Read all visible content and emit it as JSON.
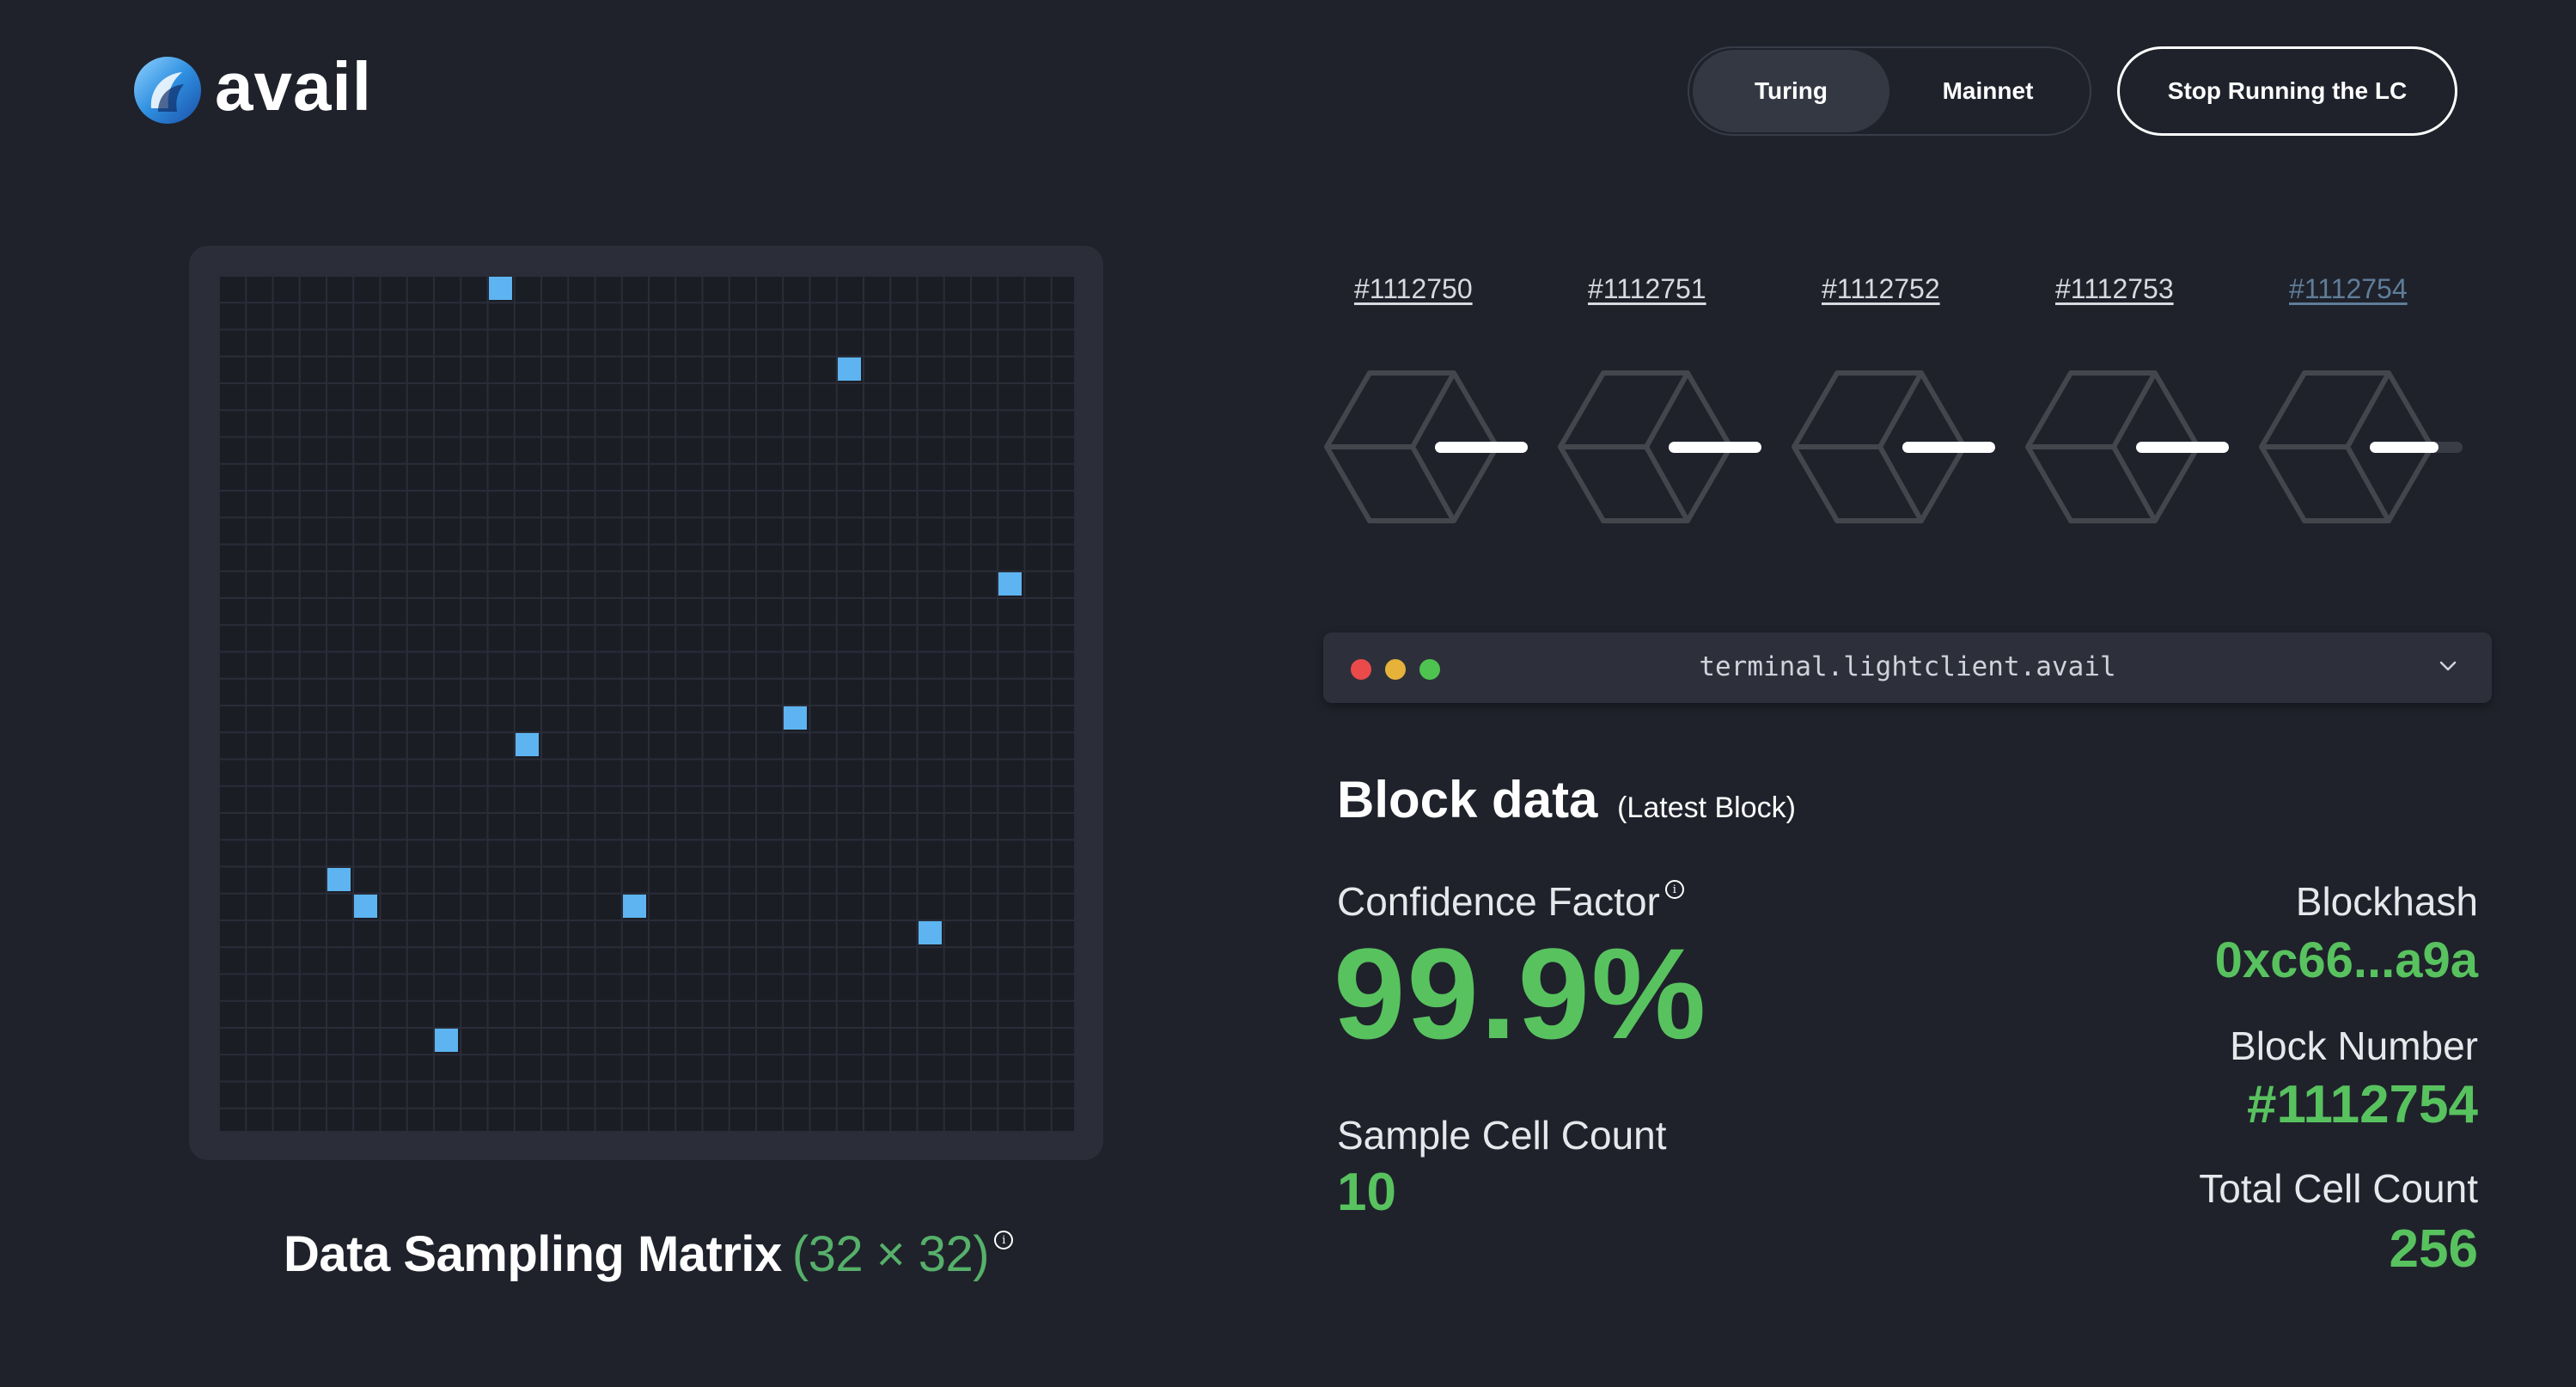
{
  "header": {
    "logo_text": "avail",
    "networks": [
      "Turing",
      "Mainnet"
    ],
    "active_network": "Turing",
    "stop_button_label": "Stop Running the LC"
  },
  "matrix": {
    "caption": "Data Sampling Matrix",
    "dimensions": "(32 × 32)",
    "rows": 32,
    "cols": 32,
    "sampled_cells": [
      {
        "row": 0,
        "col": 10
      },
      {
        "row": 3,
        "col": 23
      },
      {
        "row": 11,
        "col": 29
      },
      {
        "row": 16,
        "col": 21
      },
      {
        "row": 17,
        "col": 11
      },
      {
        "row": 22,
        "col": 4
      },
      {
        "row": 23,
        "col": 5
      },
      {
        "row": 23,
        "col": 15
      },
      {
        "row": 24,
        "col": 26
      },
      {
        "row": 28,
        "col": 8
      }
    ],
    "cell_color": "#5db4f0"
  },
  "blocks": [
    {
      "label": "#1112750",
      "progress": 1.0
    },
    {
      "label": "#1112751",
      "progress": 1.0
    },
    {
      "label": "#1112752",
      "progress": 1.0
    },
    {
      "label": "#1112753",
      "progress": 1.0
    },
    {
      "label": "#1112754",
      "progress": 0.74,
      "latest": true
    }
  ],
  "terminal": {
    "title": "terminal.lightclient.avail"
  },
  "block_data": {
    "title": "Block data",
    "subtitle": "(Latest Block)",
    "confidence_label": "Confidence Factor",
    "confidence_value": "99.9%",
    "sample_cell_label": "Sample Cell Count",
    "sample_cell_value": "10",
    "blockhash_label": "Blockhash",
    "blockhash_value": "0xc66...a9a",
    "block_number_label": "Block Number",
    "block_number_value": "#1112754",
    "total_cell_label": "Total Cell Count",
    "total_cell_value": "256",
    "accent_color": "#58c25f"
  }
}
